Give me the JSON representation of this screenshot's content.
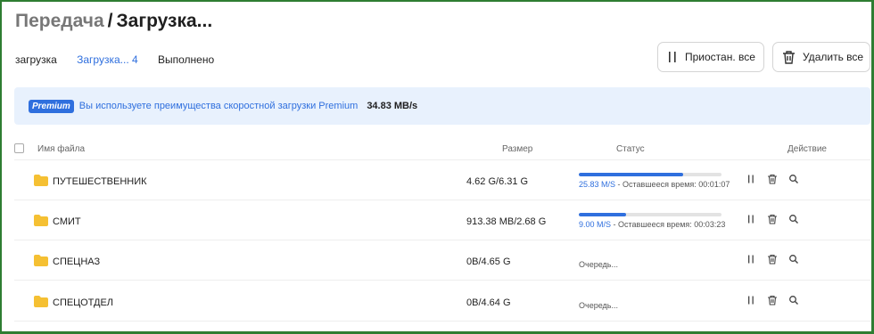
{
  "header": {
    "crumb_parent": "Передача",
    "crumb_sep": "/",
    "crumb_current": "Загрузка..."
  },
  "tabs": [
    {
      "label": "загрузка"
    },
    {
      "label": "Загрузка... 4"
    },
    {
      "label": "Выполнено"
    }
  ],
  "toolbar": {
    "pause_all_label": "Приостан. все",
    "delete_all_label": "Удалить все"
  },
  "banner": {
    "badge": "Premium",
    "text": "Вы используете преимущества скоростной загрузки Premium",
    "speed": "34.83 MB/s"
  },
  "table": {
    "columns": {
      "name": "Имя файла",
      "size": "Размер",
      "status": "Статус",
      "action": "Действие"
    },
    "rows": [
      {
        "name": "ПУТЕШЕСТВЕННИК",
        "size": "4.62 G/6.31 G",
        "state": "downloading",
        "progress": 0.73,
        "speed": "25.83 M/S",
        "remaining": " - Оставшееся время: 00:01:07",
        "queued": ""
      },
      {
        "name": "СМИТ",
        "size": "913.38 MB/2.68 G",
        "state": "downloading",
        "progress": 0.33,
        "speed": "9.00 M/S",
        "remaining": " - Оставшееся время: 00:03:23",
        "queued": ""
      },
      {
        "name": "СПЕЦНАЗ",
        "size": "0B/4.65 G",
        "state": "queued",
        "progress": 0,
        "speed": "",
        "remaining": "",
        "queued": "Очередь..."
      },
      {
        "name": "СПЕЦОТДЕЛ",
        "size": "0B/4.64 G",
        "state": "queued",
        "progress": 0,
        "speed": "",
        "remaining": "",
        "queued": "Очередь..."
      }
    ]
  },
  "colors": {
    "accent": "#2f6fde",
    "folder": "#f5c033",
    "banner_bg": "#e8f1fd",
    "frame": "#2e7d32"
  },
  "icons": {
    "pause": "pause-icon",
    "delete": "trash-icon",
    "search": "search-icon",
    "folder": "folder-icon"
  }
}
